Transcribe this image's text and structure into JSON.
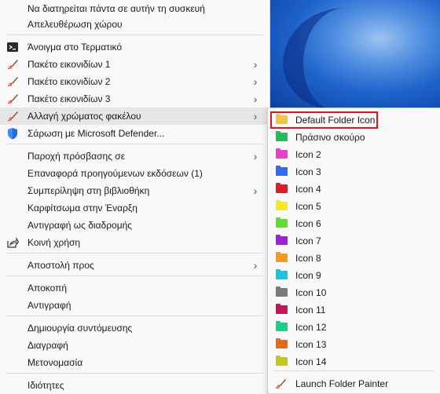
{
  "menu": {
    "items": [
      {
        "label": "Να διατηρείται πάντα σε αυτήν τη συσκευή",
        "icon": "",
        "arrow": false
      },
      {
        "label": "Απελευθέρωση χώρου",
        "icon": "",
        "arrow": false
      },
      {
        "label": "Άνοιγμα στο Τερματικό",
        "icon": "terminal-icon",
        "arrow": false
      },
      {
        "label": "Πακέτο εικονιδίων 1",
        "icon": "folder-painter-brush-icon",
        "arrow": true
      },
      {
        "label": "Πακέτο εικονιδίων 2",
        "icon": "folder-painter-brush-icon",
        "arrow": true
      },
      {
        "label": "Πακέτο εικονιδίων 3",
        "icon": "folder-painter-brush-icon",
        "arrow": true
      },
      {
        "label": "Αλλαγή χρώματος φακέλου",
        "icon": "folder-painter-brush-icon",
        "arrow": true
      },
      {
        "label": "Σάρωση με Microsoft Defender...",
        "icon": "defender-shield-icon",
        "arrow": false
      },
      {
        "label": "Παροχή πρόσβασης σε",
        "icon": "",
        "arrow": true
      },
      {
        "label": "Επαναφορά προηγούμενων εκδόσεων (1)",
        "icon": "",
        "arrow": false
      },
      {
        "label": "Συμπερίληψη στη βιβλιοθήκη",
        "icon": "",
        "arrow": true
      },
      {
        "label": "Καρφίτσωμα στην Έναρξη",
        "icon": "",
        "arrow": false
      },
      {
        "label": "Αντιγραφή ως διαδρομής",
        "icon": "",
        "arrow": false
      },
      {
        "label": "Κοινή χρήση",
        "icon": "share-icon",
        "arrow": false
      },
      {
        "label": "Αποστολή προς",
        "icon": "",
        "arrow": true
      },
      {
        "label": "Αποκοπή",
        "icon": "",
        "arrow": false
      },
      {
        "label": "Αντιγραφή",
        "icon": "",
        "arrow": false
      },
      {
        "label": "Δημιουργία συντόμευσης",
        "icon": "",
        "arrow": false
      },
      {
        "label": "Διαγραφή",
        "icon": "",
        "arrow": false
      },
      {
        "label": "Μετονομασία",
        "icon": "",
        "arrow": false
      },
      {
        "label": "Ιδιότητες",
        "icon": "",
        "arrow": false
      }
    ],
    "chevron": "›"
  },
  "submenu": {
    "items": [
      {
        "label": "Default Folder Icon",
        "color": "#f5c542",
        "highlighted": true
      },
      {
        "label": "Πράσινο σκούρο",
        "color": "#1fbf5a"
      },
      {
        "label": "Icon 2",
        "color": "#f03dd0"
      },
      {
        "label": "Icon 3",
        "color": "#2f6bf0"
      },
      {
        "label": "Icon 4",
        "color": "#e01b24"
      },
      {
        "label": "Icon 5",
        "color": "#f2ea1a"
      },
      {
        "label": "Icon 6",
        "color": "#5ee12a"
      },
      {
        "label": "Icon 7",
        "color": "#a21fd8"
      },
      {
        "label": "Icon 8",
        "color": "#f59a1c"
      },
      {
        "label": "Icon 9",
        "color": "#14c7e0"
      },
      {
        "label": "Icon 10",
        "color": "#7a7a7a"
      },
      {
        "label": "Icon 11",
        "color": "#c8155a"
      },
      {
        "label": "Icon 12",
        "color": "#12d38a"
      },
      {
        "label": "Icon 13",
        "color": "#e86a10"
      },
      {
        "label": "Icon 14",
        "color": "#c7c41c"
      }
    ],
    "footer": {
      "label": "Launch Folder Painter",
      "icon": "folder-painter-brush-icon"
    }
  }
}
